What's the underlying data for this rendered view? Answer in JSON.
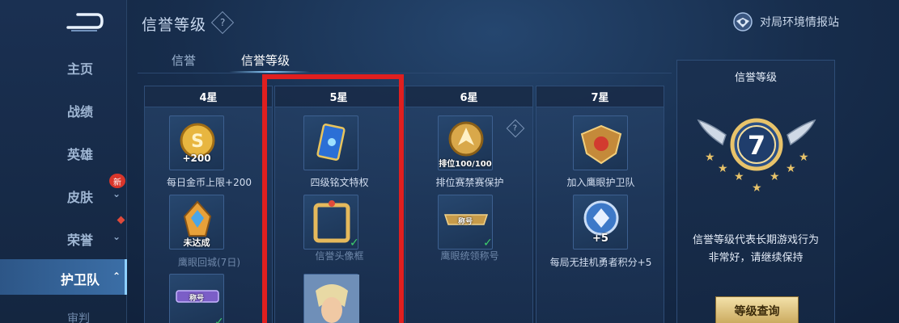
{
  "sidebar": {
    "items": [
      {
        "label": "主页"
      },
      {
        "label": "战绩"
      },
      {
        "label": "英雄"
      },
      {
        "label": "皮肤",
        "badge": "新"
      },
      {
        "label": "荣誉"
      },
      {
        "label": "护卫队",
        "active": true
      },
      {
        "label": "审判"
      }
    ]
  },
  "header": {
    "title": "信誉等级",
    "help_symbol": "?",
    "env_button": "对局环境情报站"
  },
  "tabs": [
    {
      "label": "信誉"
    },
    {
      "label": "信誉等级",
      "active": true
    }
  ],
  "columns": [
    {
      "title": "4星",
      "items": [
        {
          "label": "每日金币上限+200",
          "icon": "gold-coin-icon",
          "icon_text": "+200"
        },
        {
          "label": "鹰眼回城(7日)",
          "icon": "hawk-eye-recall-icon",
          "icon_text": "未达成",
          "dim": true
        },
        {
          "label": "",
          "icon": "title-plaque-icon",
          "icon_text": "称号"
        }
      ]
    },
    {
      "title": "5星",
      "items": [
        {
          "label": "四级铭文特权",
          "icon": "inscription-card-icon"
        },
        {
          "label": "信誉头像框",
          "icon": "avatar-frame-icon",
          "dim": true,
          "done": true
        },
        {
          "label": "",
          "icon": "hero-portrait-icon"
        }
      ]
    },
    {
      "title": "6星",
      "items": [
        {
          "label": "排位赛禁赛保护",
          "icon": "rank-shield-icon",
          "icon_text": "排位100/100"
        },
        {
          "label": "鹰眼统领称号",
          "icon": "title-plaque-icon",
          "icon_text": "称号",
          "dim": true,
          "done": true
        }
      ]
    },
    {
      "title": "7星",
      "items": [
        {
          "label": "加入鹰眼护卫队",
          "icon": "guard-emblem-icon"
        },
        {
          "label": "每局无挂机勇者积分+5",
          "icon": "brave-points-icon",
          "icon_text": "+5"
        }
      ]
    }
  ],
  "right_panel": {
    "title": "信誉等级",
    "level": "7",
    "desc_line1": "信誉等级代表长期游戏行为",
    "desc_line2": "非常好，请继续保持",
    "button": "等级查询"
  },
  "colors": {
    "accent_gold": "#e8c36a",
    "highlight_red": "#e01f1f",
    "check_green": "#3ecf6c"
  }
}
